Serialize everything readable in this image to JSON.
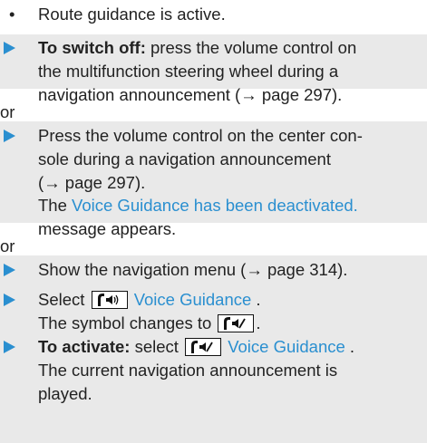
{
  "condition": "Route guidance is active.",
  "step_switch_off": {
    "lead": "To switch off:",
    "line1_rest": " press the volume control on",
    "line2": "the multifunction steering wheel during a",
    "line3": "navigation announcement (→ page 297)."
  },
  "or_1": "or",
  "step_console": {
    "line1": "Press the volume control on the center con-",
    "line2": "sole during a navigation announcement",
    "line3": "(→ page 297).",
    "line4_prefix": "The ",
    "message": "Voice Guidance has been deactivated.",
    "line5": "message appears."
  },
  "or_2": "or",
  "step_menu": "Show the navigation menu (→ page 314).",
  "step_select": {
    "prefix": "Select ",
    "label": "Voice Guidance",
    "suffix": " ."
  },
  "symbol_note": {
    "prefix": "The symbol changes to ",
    "suffix": "."
  },
  "step_activate": {
    "lead": "To activate:",
    "mid": " select ",
    "label": "Voice Guidance",
    "suffix": " ."
  },
  "result": {
    "line1": "The current navigation announcement is",
    "line2": "played."
  },
  "icons": {
    "arrow": "blue-triangle-arrow-icon",
    "voice_on": "voice-guidance-on-icon",
    "voice_off": "voice-guidance-off-icon"
  },
  "colors": {
    "accent": "#2a8fd0",
    "shade": "#e9e9e9",
    "text": "#222222"
  }
}
